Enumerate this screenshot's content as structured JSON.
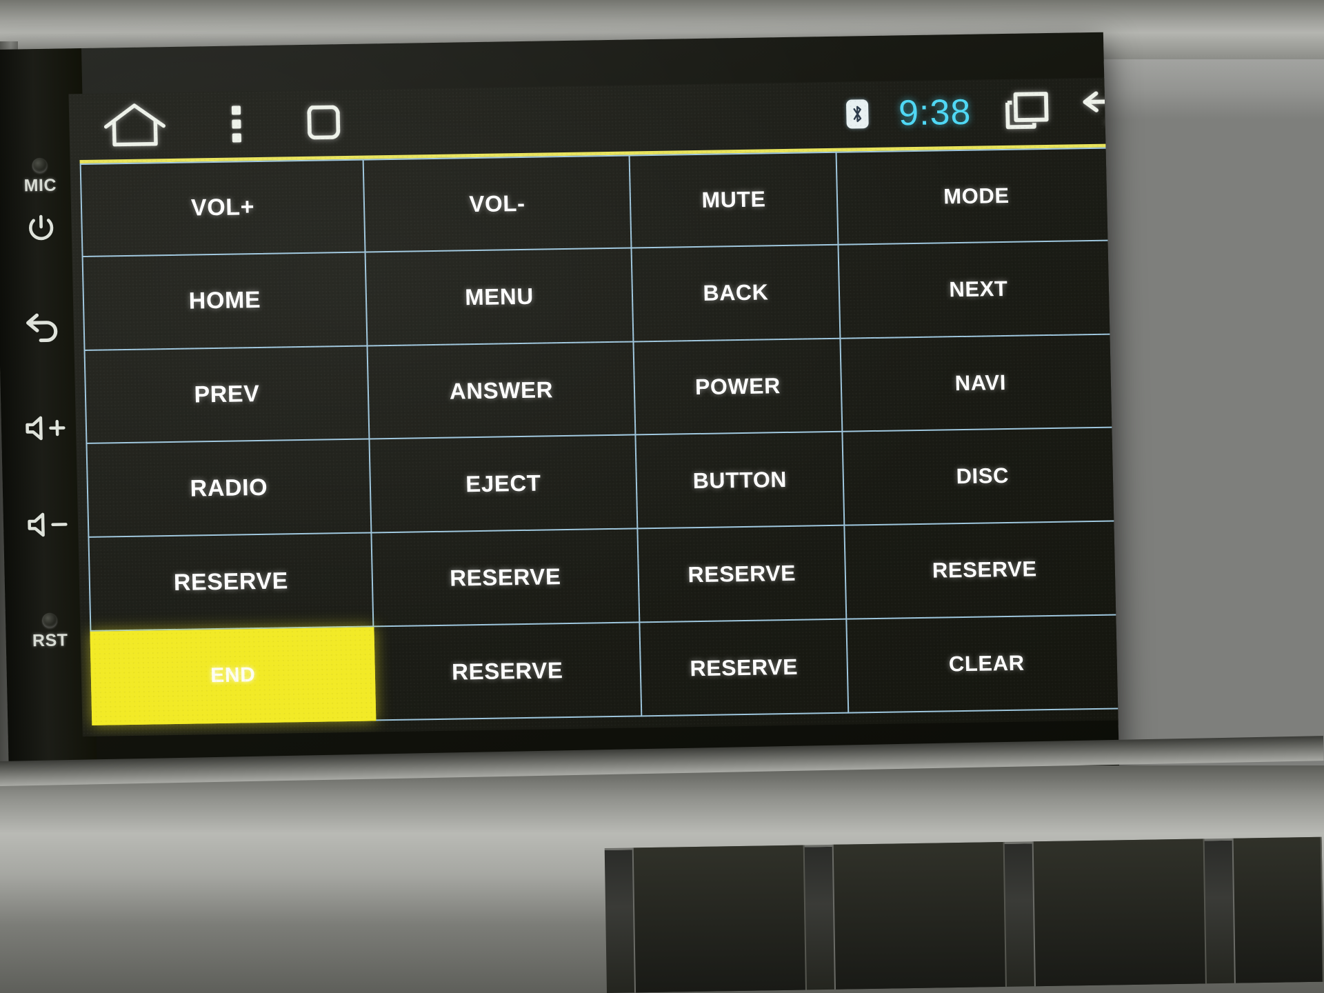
{
  "device": {
    "bezel_buttons": [
      {
        "name": "mic",
        "label": "MIC",
        "icon": "microphone-pinhole"
      },
      {
        "name": "power",
        "label": "",
        "icon": "power-icon"
      },
      {
        "name": "back",
        "label": "",
        "icon": "back-arrow-icon"
      },
      {
        "name": "volume-up",
        "label": "",
        "icon": "volume-up-icon"
      },
      {
        "name": "volume-down",
        "label": "",
        "icon": "volume-down-icon"
      },
      {
        "name": "reset",
        "label": "RST",
        "icon": "reset-pinhole"
      }
    ]
  },
  "statusbar": {
    "home_icon": "home-icon",
    "overflow_icon": "more-vertical-icon",
    "recents_icon": "recents-square-icon",
    "bluetooth_icon": "bluetooth-icon",
    "clock": "9:38",
    "multiwindow_icon": "multi-window-icon",
    "back_icon": "back-arrow-icon"
  },
  "theme": {
    "accent_top_line": "#e9e45a",
    "grid_line": "#9fc7de",
    "selected_bg": "#f2ea26",
    "clock_color": "#4fd8f5",
    "screen_bg": "#1d1e18",
    "text_color": "#ffffff"
  },
  "grid": {
    "columns": 4,
    "rows": 6,
    "selected_index": 20,
    "cells": [
      {
        "label": "VOL+",
        "selected": false
      },
      {
        "label": "VOL-",
        "selected": false
      },
      {
        "label": "MUTE",
        "selected": false
      },
      {
        "label": "MODE",
        "selected": false
      },
      {
        "label": "HOME",
        "selected": false
      },
      {
        "label": "MENU",
        "selected": false
      },
      {
        "label": "BACK",
        "selected": false
      },
      {
        "label": "NEXT",
        "selected": false
      },
      {
        "label": "PREV",
        "selected": false
      },
      {
        "label": "ANSWER",
        "selected": false
      },
      {
        "label": "POWER",
        "selected": false
      },
      {
        "label": "NAVI",
        "selected": false
      },
      {
        "label": "RADIO",
        "selected": false
      },
      {
        "label": "EJECT",
        "selected": false
      },
      {
        "label": "BUTTON",
        "selected": false
      },
      {
        "label": "DISC",
        "selected": false
      },
      {
        "label": "RESERVE",
        "selected": false
      },
      {
        "label": "RESERVE",
        "selected": false
      },
      {
        "label": "RESERVE",
        "selected": false
      },
      {
        "label": "RESERVE",
        "selected": false
      },
      {
        "label": "END",
        "selected": true
      },
      {
        "label": "RESERVE",
        "selected": false
      },
      {
        "label": "RESERVE",
        "selected": false
      },
      {
        "label": "CLEAR",
        "selected": false
      }
    ]
  }
}
